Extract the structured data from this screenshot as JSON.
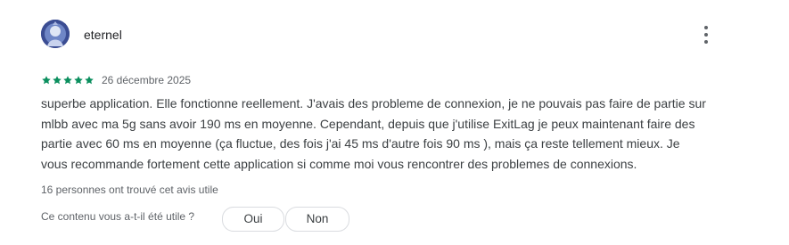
{
  "review": {
    "author": "eternel",
    "rating": 5,
    "rating_max": 5,
    "date": "26 décembre 2025",
    "lines": [
      "superbe application. Elle fonctionne reellement. J'avais des probleme de connexion, je ne pouvais pas faire de partie sur",
      "mlbb avec ma 5g sans avoir 190 ms en moyenne. Cependant, depuis que j'utilise ExitLag je peux maintenant faire des",
      "partie avec 60 ms en moyenne (ça fluctue, des fois j'ai 45 ms d'autre fois 90 ms ), mais ça reste tellement mieux. Je",
      "vous recommande fortement cette application si comme moi vous rencontrer des problemes de connexions."
    ],
    "helpful_count_text": "16 personnes ont trouvé cet avis utile",
    "helpful_question": "Ce contenu vous a-t-il été utile ?",
    "yes_label": "Oui",
    "no_label": "Non",
    "more_icon": "more-vert-icon",
    "star_color": "#0b8f5e"
  }
}
